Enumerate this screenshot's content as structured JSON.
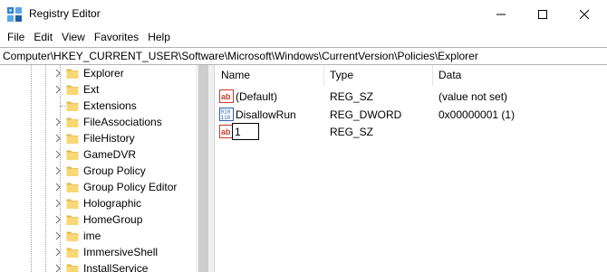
{
  "window": {
    "title": "Registry Editor"
  },
  "menu": {
    "items": [
      "File",
      "Edit",
      "View",
      "Favorites",
      "Help"
    ]
  },
  "address": {
    "path": "Computer\\HKEY_CURRENT_USER\\Software\\Microsoft\\Windows\\CurrentVersion\\Policies\\Explorer"
  },
  "tree": {
    "items": [
      {
        "label": "Explorer",
        "expandable": true
      },
      {
        "label": "Ext",
        "expandable": true
      },
      {
        "label": "Extensions",
        "expandable": false
      },
      {
        "label": "FileAssociations",
        "expandable": true
      },
      {
        "label": "FileHistory",
        "expandable": true
      },
      {
        "label": "GameDVR",
        "expandable": true
      },
      {
        "label": "Group Policy",
        "expandable": true
      },
      {
        "label": "Group Policy Editor",
        "expandable": true
      },
      {
        "label": "Holographic",
        "expandable": true
      },
      {
        "label": "HomeGroup",
        "expandable": true
      },
      {
        "label": "ime",
        "expandable": true
      },
      {
        "label": "ImmersiveShell",
        "expandable": true
      },
      {
        "label": "InstallService",
        "expandable": true
      }
    ]
  },
  "values": {
    "headers": {
      "name": "Name",
      "type": "Type",
      "data": "Data"
    },
    "rows": [
      {
        "icon": "string-value-icon",
        "name": "(Default)",
        "type": "REG_SZ",
        "data": "(value not set)"
      },
      {
        "icon": "binary-value-icon",
        "name": "DisallowRun",
        "type": "REG_DWORD",
        "data": "0x00000001 (1)"
      },
      {
        "icon": "string-value-icon",
        "name": "1",
        "type": "REG_SZ",
        "data": "",
        "editing": true
      }
    ]
  },
  "colors": {
    "folder": "#f8d775",
    "folder_dark": "#e0b442",
    "string_icon": "#c8382a",
    "binary_icon": "#2a5fb5"
  }
}
